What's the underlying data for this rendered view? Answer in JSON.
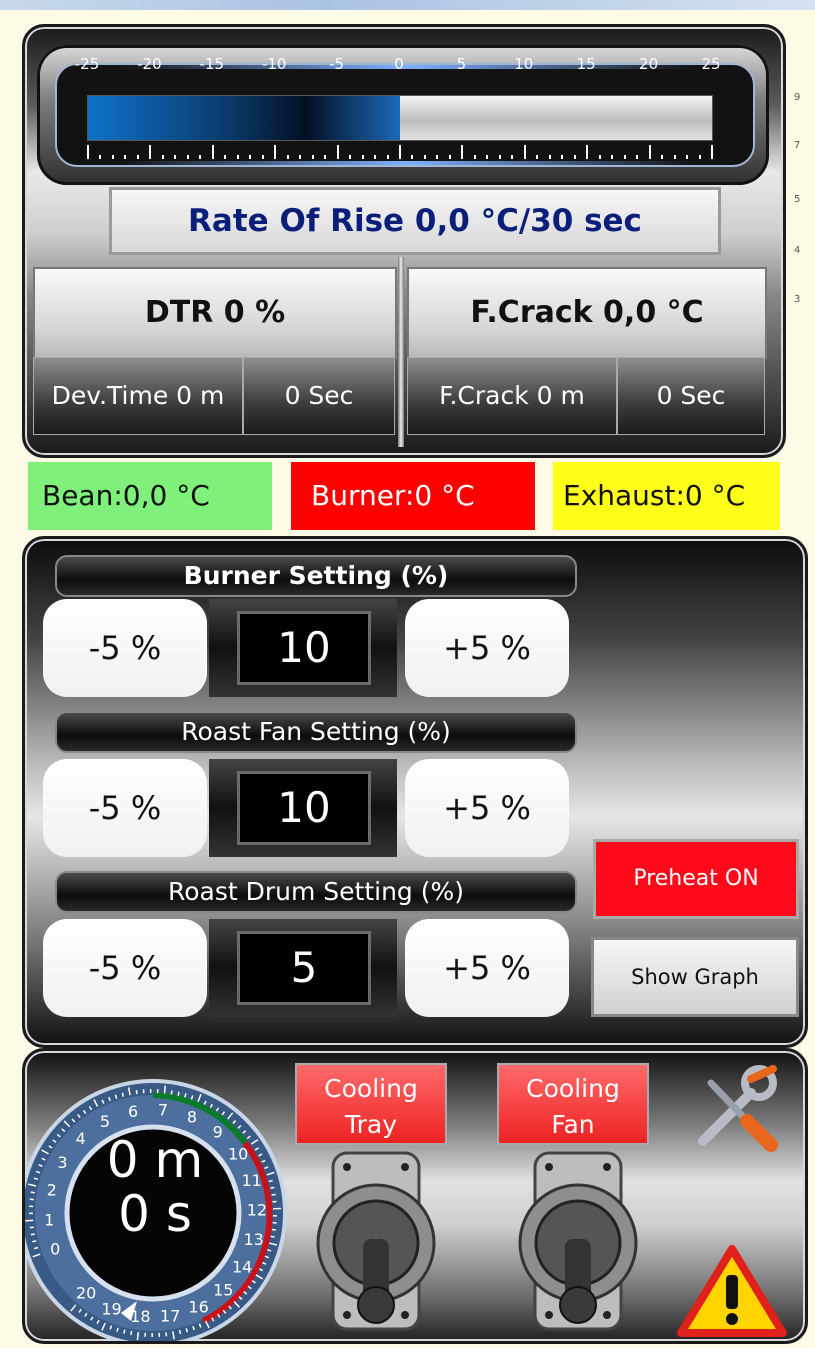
{
  "gauge": {
    "tick_labels": [
      "-25",
      "-20",
      "-15",
      "-10",
      "-5",
      "0",
      "5",
      "10",
      "15",
      "20",
      "25"
    ],
    "value": 0,
    "min": -25,
    "max": 25
  },
  "ror": {
    "text": "Rate Of Rise 0,0  °C/30 sec"
  },
  "dtr": {
    "label": "DTR 0   %",
    "dev_time_min": "Dev.Time 0 m",
    "dev_time_sec": "0 Sec"
  },
  "fcrack": {
    "label": "F.Crack 0,0   °C",
    "time_min": "F.Crack 0 m",
    "time_sec": "0 Sec"
  },
  "temps": {
    "bean": "Bean:0,0 °C",
    "burner": "Burner:0 °C",
    "exhaust": "Exhaust:0 °C",
    "colors": {
      "bean": "#7ff07a",
      "burner": "#ff0000",
      "exhaust": "#ffff1a"
    }
  },
  "settings": [
    {
      "title": "Burner Setting (%)",
      "minus": "-5 %",
      "value": "10",
      "plus": "+5 %"
    },
    {
      "title": "Roast Fan Setting (%)",
      "minus": "-5 %",
      "value": "10",
      "plus": "+5 %"
    },
    {
      "title": "Roast Drum Setting (%)",
      "minus": "-5 %",
      "value": "5",
      "plus": "+5 %"
    }
  ],
  "buttons": {
    "preheat": "Preheat ON",
    "show_graph": "Show Graph"
  },
  "timer": {
    "minutes": "0 m",
    "seconds": "0 s",
    "dial_numbers": [
      "0",
      "1",
      "2",
      "3",
      "4",
      "5",
      "6",
      "7",
      "8",
      "9",
      "10",
      "11",
      "12",
      "13",
      "14",
      "15",
      "16",
      "17",
      "18",
      "19",
      "20"
    ]
  },
  "cooling": {
    "tray": [
      "Cooling",
      "Tray"
    ],
    "fan": [
      "Cooling",
      "Fan"
    ]
  },
  "side_marks": [
    "9",
    "7",
    "5",
    "4",
    "3"
  ],
  "icons": [
    "tools-icon",
    "warning-icon",
    "toggle-switch-icon"
  ]
}
